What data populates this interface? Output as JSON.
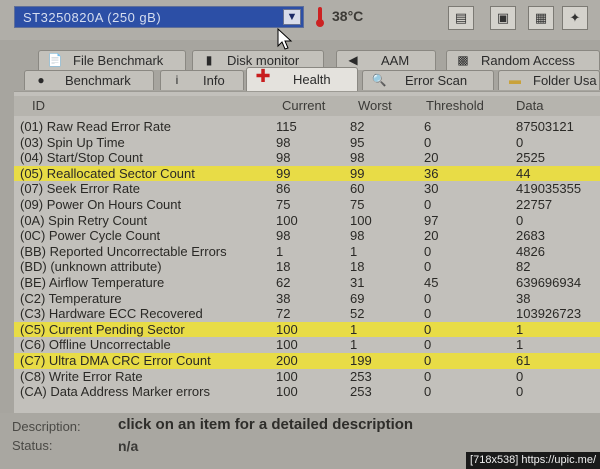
{
  "header": {
    "drive": "ST3250820A (250 gB)",
    "temperature": "38°C",
    "toolbar_icons": [
      "copy-text-icon",
      "copy-screenshot-icon",
      "save-icon",
      "options-icon"
    ]
  },
  "tabs_top": [
    {
      "label": "File Benchmark",
      "icon": "file-benchmark-icon"
    },
    {
      "label": "Disk monitor",
      "icon": "disk-monitor-icon"
    },
    {
      "label": "AAM",
      "icon": "speaker-icon"
    },
    {
      "label": "Random Access",
      "icon": "random-access-icon"
    }
  ],
  "tabs_bottom": [
    {
      "label": "Benchmark",
      "icon": "benchmark-icon"
    },
    {
      "label": "Info",
      "icon": "info-icon"
    },
    {
      "label": "Health",
      "icon": "health-icon",
      "active": true
    },
    {
      "label": "Error Scan",
      "icon": "search-icon"
    },
    {
      "label": "Folder Usa",
      "icon": "folder-icon"
    }
  ],
  "table": {
    "columns": [
      "ID",
      "Current",
      "Worst",
      "Threshold",
      "Data"
    ],
    "highlight_color": "#e8dc46",
    "rows": [
      {
        "id": "(01) Raw Read Error Rate",
        "current": "115",
        "worst": "82",
        "threshold": "6",
        "data": "87503121",
        "highlight": false
      },
      {
        "id": "(03) Spin Up Time",
        "current": "98",
        "worst": "95",
        "threshold": "0",
        "data": "0",
        "highlight": false
      },
      {
        "id": "(04) Start/Stop Count",
        "current": "98",
        "worst": "98",
        "threshold": "20",
        "data": "2525",
        "highlight": false
      },
      {
        "id": "(05) Reallocated Sector Count",
        "current": "99",
        "worst": "99",
        "threshold": "36",
        "data": "44",
        "highlight": true
      },
      {
        "id": "(07) Seek Error Rate",
        "current": "86",
        "worst": "60",
        "threshold": "30",
        "data": "419035355",
        "highlight": false
      },
      {
        "id": "(09) Power On Hours Count",
        "current": "75",
        "worst": "75",
        "threshold": "0",
        "data": "22757",
        "highlight": false
      },
      {
        "id": "(0A) Spin Retry Count",
        "current": "100",
        "worst": "100",
        "threshold": "97",
        "data": "0",
        "highlight": false
      },
      {
        "id": "(0C) Power Cycle Count",
        "current": "98",
        "worst": "98",
        "threshold": "20",
        "data": "2683",
        "highlight": false
      },
      {
        "id": "(BB) Reported Uncorrectable Errors",
        "current": "1",
        "worst": "1",
        "threshold": "0",
        "data": "4826",
        "highlight": false
      },
      {
        "id": "(BD) (unknown attribute)",
        "current": "18",
        "worst": "18",
        "threshold": "0",
        "data": "82",
        "highlight": false
      },
      {
        "id": "(BE) Airflow Temperature",
        "current": "62",
        "worst": "31",
        "threshold": "45",
        "data": "639696934",
        "highlight": false
      },
      {
        "id": "(C2) Temperature",
        "current": "38",
        "worst": "69",
        "threshold": "0",
        "data": "38",
        "highlight": false
      },
      {
        "id": "(C3) Hardware ECC Recovered",
        "current": "72",
        "worst": "52",
        "threshold": "0",
        "data": "103926723",
        "highlight": false
      },
      {
        "id": "(C5) Current Pending Sector",
        "current": "100",
        "worst": "1",
        "threshold": "0",
        "data": "1",
        "highlight": true
      },
      {
        "id": "(C6) Offline Uncorrectable",
        "current": "100",
        "worst": "1",
        "threshold": "0",
        "data": "1",
        "highlight": false
      },
      {
        "id": "(C7) Ultra DMA CRC Error Count",
        "current": "200",
        "worst": "199",
        "threshold": "0",
        "data": "61",
        "highlight": true
      },
      {
        "id": "(C8) Write Error Rate",
        "current": "100",
        "worst": "253",
        "threshold": "0",
        "data": "0",
        "highlight": false
      },
      {
        "id": "(CA) Data Address Marker errors",
        "current": "100",
        "worst": "253",
        "threshold": "0",
        "data": "0",
        "highlight": false
      }
    ]
  },
  "footer": {
    "description_label": "Description:",
    "description_value": "click on an item for a detailed description",
    "status_label": "Status:",
    "status_value": "n/a"
  },
  "watermark": "[718x538] https://upic.me/"
}
